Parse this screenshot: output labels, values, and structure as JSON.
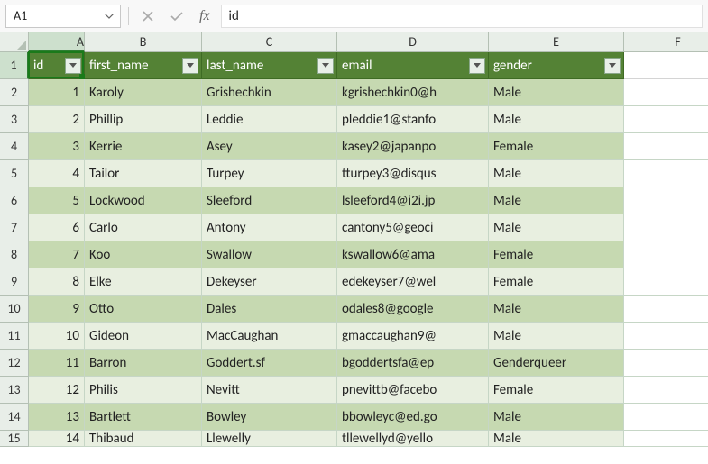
{
  "name_box": {
    "value": "A1"
  },
  "formula_bar": {
    "fx_label": "fx",
    "value": "id"
  },
  "columns": [
    "A",
    "B",
    "C",
    "D",
    "E",
    "F"
  ],
  "row_numbers": [
    1,
    2,
    3,
    4,
    5,
    6,
    7,
    8,
    9,
    10,
    11,
    12,
    13,
    14,
    15
  ],
  "headers": {
    "id": "id",
    "first_name": "first_name",
    "last_name": "last_name",
    "email": "email",
    "gender": "gender"
  },
  "data": [
    {
      "id": 1,
      "first_name": "Karoly",
      "last_name": "Grishechkin",
      "email": "kgrishechkin0@h",
      "gender": "Male"
    },
    {
      "id": 2,
      "first_name": "Phillip",
      "last_name": "Leddie",
      "email": "pleddie1@stanfo",
      "gender": "Male"
    },
    {
      "id": 3,
      "first_name": "Kerrie",
      "last_name": "Asey",
      "email": "kasey2@japanpo",
      "gender": "Female"
    },
    {
      "id": 4,
      "first_name": "Tailor",
      "last_name": "Turpey",
      "email": "tturpey3@disqus",
      "gender": "Male"
    },
    {
      "id": 5,
      "first_name": "Lockwood",
      "last_name": "Sleeford",
      "email": "lsleeford4@i2i.jp",
      "gender": "Male"
    },
    {
      "id": 6,
      "first_name": "Carlo",
      "last_name": "Antony",
      "email": "cantony5@geoci",
      "gender": "Male"
    },
    {
      "id": 7,
      "first_name": "Koo",
      "last_name": "Swallow",
      "email": "kswallow6@ama",
      "gender": "Female"
    },
    {
      "id": 8,
      "first_name": "Elke",
      "last_name": "Dekeyser",
      "email": "edekeyser7@wel",
      "gender": "Female"
    },
    {
      "id": 9,
      "first_name": "Otto",
      "last_name": "Dales",
      "email": "odales8@google",
      "gender": "Male"
    },
    {
      "id": 10,
      "first_name": "Gideon",
      "last_name": "MacCaughan",
      "email": "gmaccaughan9@",
      "gender": "Male"
    },
    {
      "id": 11,
      "first_name": "Barron",
      "last_name": "Goddert.sf",
      "email": "bgoddertsfa@ep",
      "gender": "Genderqueer"
    },
    {
      "id": 12,
      "first_name": "Philis",
      "last_name": "Nevitt",
      "email": "pnevittb@facebo",
      "gender": "Female"
    },
    {
      "id": 13,
      "first_name": "Bartlett",
      "last_name": "Bowley",
      "email": "bbowleyc@ed.go",
      "gender": "Male"
    },
    {
      "id": 14,
      "first_name": "Thibaud",
      "last_name": "Llewelly",
      "email": "tllewellyd@yello",
      "gender": "Male"
    }
  ],
  "chart_data": {
    "type": "table",
    "title": "",
    "columns": [
      "id",
      "first_name",
      "last_name",
      "email",
      "gender"
    ],
    "rows": [
      [
        1,
        "Karoly",
        "Grishechkin",
        "kgrishechkin0@h",
        "Male"
      ],
      [
        2,
        "Phillip",
        "Leddie",
        "pleddie1@stanfo",
        "Male"
      ],
      [
        3,
        "Kerrie",
        "Asey",
        "kasey2@japanpo",
        "Female"
      ],
      [
        4,
        "Tailor",
        "Turpey",
        "tturpey3@disqus",
        "Male"
      ],
      [
        5,
        "Lockwood",
        "Sleeford",
        "lsleeford4@i2i.jp",
        "Male"
      ],
      [
        6,
        "Carlo",
        "Antony",
        "cantony5@geoci",
        "Male"
      ],
      [
        7,
        "Koo",
        "Swallow",
        "kswallow6@ama",
        "Female"
      ],
      [
        8,
        "Elke",
        "Dekeyser",
        "edekeyser7@wel",
        "Female"
      ],
      [
        9,
        "Otto",
        "Dales",
        "odales8@google",
        "Male"
      ],
      [
        10,
        "Gideon",
        "MacCaughan",
        "gmaccaughan9@",
        "Male"
      ],
      [
        11,
        "Barron",
        "Goddert.sf",
        "bgoddertsfa@ep",
        "Genderqueer"
      ],
      [
        12,
        "Philis",
        "Nevitt",
        "pnevittb@facebo",
        "Female"
      ],
      [
        13,
        "Bartlett",
        "Bowley",
        "bbowleyc@ed.go",
        "Male"
      ],
      [
        14,
        "Thibaud",
        "Llewelly",
        "tllewellyd@yello",
        "Male"
      ]
    ]
  }
}
